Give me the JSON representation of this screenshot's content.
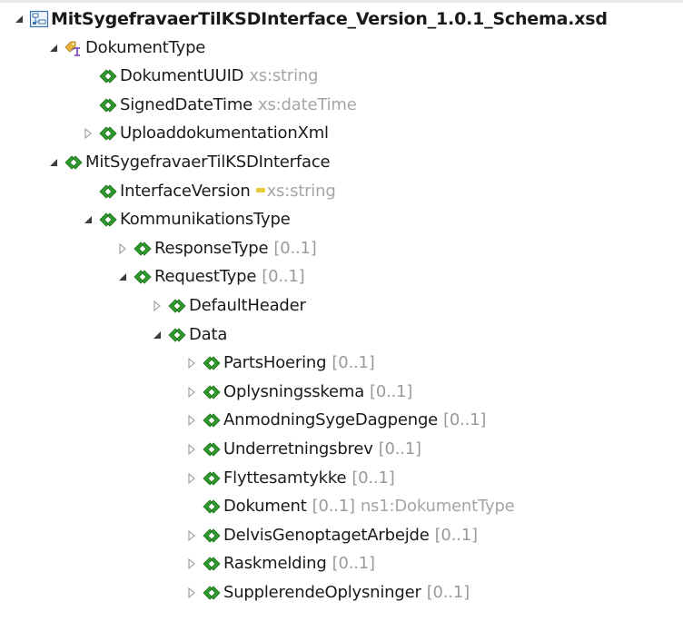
{
  "tree": {
    "root": {
      "label": "MitSygefravaerTilKSDInterface_Version_1.0.1_Schema.xsd",
      "icon": "schema-icon",
      "expanded": true
    },
    "nodes": [
      {
        "label": "DokumentType",
        "icon": "complex-type-icon",
        "depth": 1,
        "toggle": "expanded"
      },
      {
        "label": "DokumentUUID",
        "type": "xs:string",
        "icon": "element-icon",
        "depth": 2,
        "toggle": "none"
      },
      {
        "label": "SignedDateTime",
        "type": "xs:dateTime",
        "icon": "element-icon",
        "depth": 2,
        "toggle": "none"
      },
      {
        "label": "UploaddokumentationXml",
        "icon": "element-icon",
        "depth": 2,
        "toggle": "collapsed"
      },
      {
        "label": "MitSygefravaerTilKSDInterface",
        "icon": "element-icon",
        "depth": 1,
        "toggle": "expanded"
      },
      {
        "label": "InterfaceVersion",
        "type": "xs:string",
        "type_marker": true,
        "icon": "element-icon",
        "depth": 2,
        "toggle": "none"
      },
      {
        "label": "KommunikationsType",
        "icon": "element-icon",
        "depth": 2,
        "toggle": "expanded"
      },
      {
        "label": "ResponseType",
        "mult": "[0..1]",
        "icon": "element-icon",
        "depth": 3,
        "toggle": "collapsed"
      },
      {
        "label": "RequestType",
        "mult": "[0..1]",
        "icon": "element-icon",
        "depth": 3,
        "toggle": "expanded"
      },
      {
        "label": "DefaultHeader",
        "icon": "element-icon",
        "depth": 4,
        "toggle": "collapsed"
      },
      {
        "label": "Data",
        "icon": "element-icon",
        "depth": 4,
        "toggle": "expanded"
      },
      {
        "label": "PartsHoering",
        "mult": "[0..1]",
        "icon": "element-icon",
        "depth": 5,
        "toggle": "collapsed"
      },
      {
        "label": "Oplysningsskema",
        "mult": "[0..1]",
        "icon": "element-icon",
        "depth": 5,
        "toggle": "collapsed"
      },
      {
        "label": "AnmodningSygeDagpenge",
        "mult": "[0..1]",
        "icon": "element-icon",
        "depth": 5,
        "toggle": "collapsed"
      },
      {
        "label": "Underretningsbrev",
        "mult": "[0..1]",
        "icon": "element-icon",
        "depth": 5,
        "toggle": "collapsed"
      },
      {
        "label": "Flyttesamtykke",
        "mult": "[0..1]",
        "icon": "element-icon",
        "depth": 5,
        "toggle": "collapsed"
      },
      {
        "label": "Dokument",
        "mult": "[0..1]",
        "type": "ns1:DokumentType",
        "icon": "element-icon",
        "depth": 5,
        "toggle": "none"
      },
      {
        "label": "DelvisGenoptagetArbejde",
        "mult": "[0..1]",
        "icon": "element-icon",
        "depth": 5,
        "toggle": "collapsed"
      },
      {
        "label": "Raskmelding",
        "mult": "[0..1]",
        "icon": "element-icon",
        "depth": 5,
        "toggle": "collapsed"
      },
      {
        "label": "SupplerendeOplysninger",
        "mult": "[0..1]",
        "icon": "element-icon",
        "depth": 5,
        "toggle": "collapsed"
      }
    ]
  },
  "colors": {
    "element_green": "#2f9a2c",
    "element_green_dark": "#1c6f1a",
    "muted_text": "#a0a0a0",
    "schema_blue": "#3a6fb0"
  }
}
